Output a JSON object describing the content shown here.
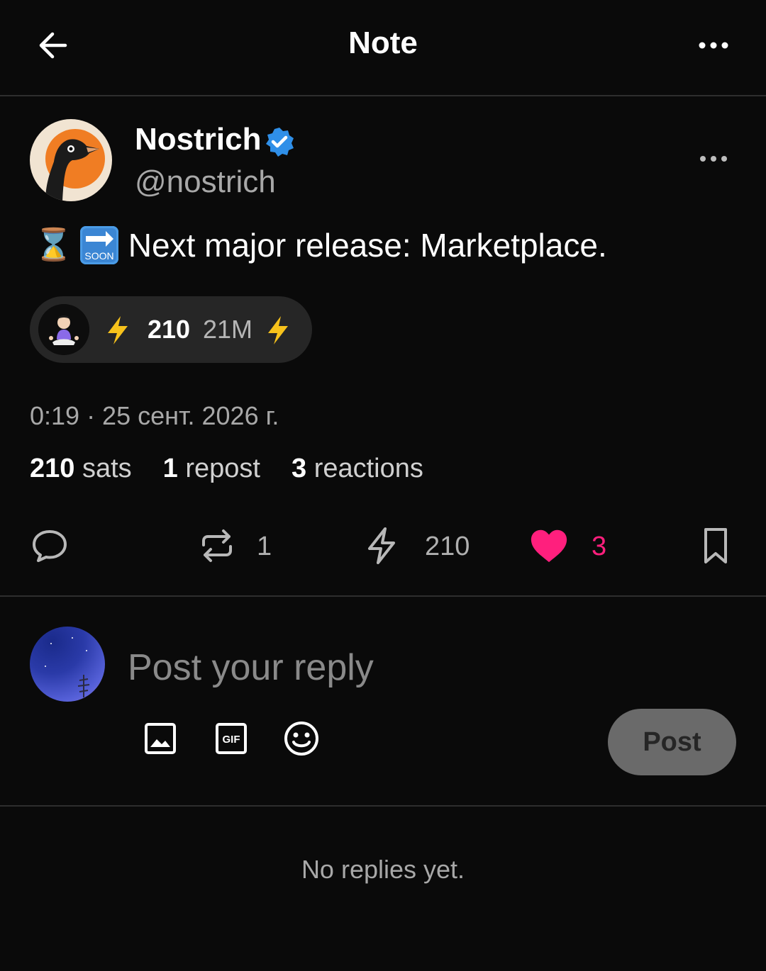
{
  "header": {
    "title": "Note",
    "back_icon": "arrow-left-icon",
    "more_icon": "more-horizontal-icon"
  },
  "author": {
    "name": "Nostrich",
    "handle": "@nostrich",
    "verified": true,
    "avatar": "ostrich-avatar"
  },
  "post": {
    "emoji_1": "⌛",
    "emoji_2": "🔜",
    "emoji_2_label": "SOON",
    "text": "Next major release: Marketplace.",
    "timestamp": "0:19 · 25 сент. 2026 г."
  },
  "zap_chip": {
    "amount": "210",
    "note": "21M"
  },
  "stats": {
    "sats_count": "210",
    "sats_label": "sats",
    "repost_count": "1",
    "repost_label": "repost",
    "reactions_count": "3",
    "reactions_label": "reactions"
  },
  "actions": {
    "repost_count": "1",
    "zap_count": "210",
    "like_count": "3"
  },
  "reply": {
    "placeholder": "Post your reply",
    "post_label": "Post",
    "gif_label": "GIF"
  },
  "replies": {
    "empty_text": "No replies yet."
  },
  "colors": {
    "background": "#0a0a0a",
    "verified": "#2f8fe8",
    "zap": "#f7c21b",
    "like": "#ff1f7d",
    "avatar_orange": "#f07d23"
  }
}
